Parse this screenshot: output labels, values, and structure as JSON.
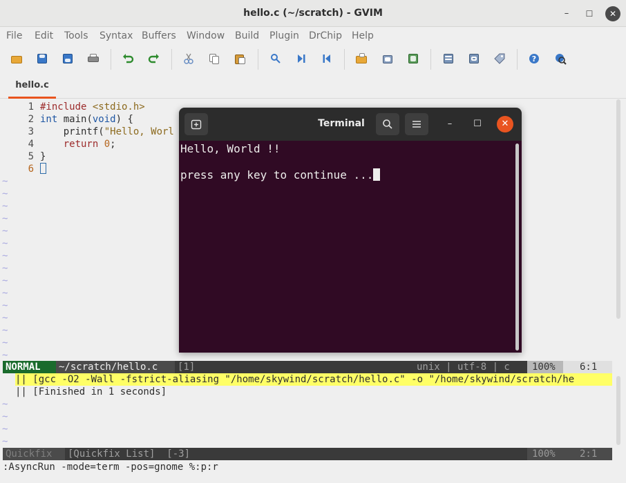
{
  "window": {
    "title": "hello.c (~/scratch) - GVIM"
  },
  "menu": [
    "File",
    "Edit",
    "Tools",
    "Syntax",
    "Buffers",
    "Window",
    "Build",
    "Plugin",
    "DrChip",
    "Help"
  ],
  "tab": {
    "label": "hello.c"
  },
  "editor": {
    "lines": [
      {
        "num": "1",
        "segments": [
          {
            "t": "#include ",
            "c": "kw"
          },
          {
            "t": "<stdio.h>",
            "c": "str"
          }
        ]
      },
      {
        "num": "2",
        "segments": [
          {
            "t": "int",
            "c": "ty"
          },
          {
            "t": " main(",
            "c": ""
          },
          {
            "t": "void",
            "c": "ty"
          },
          {
            "t": ") {",
            "c": ""
          }
        ]
      },
      {
        "num": "3",
        "segments": [
          {
            "t": "    printf(",
            "c": ""
          },
          {
            "t": "\"Hello, Worl",
            "c": "str"
          }
        ]
      },
      {
        "num": "4",
        "segments": [
          {
            "t": "    ",
            "c": ""
          },
          {
            "t": "return",
            "c": "kw"
          },
          {
            "t": " ",
            "c": ""
          },
          {
            "t": "0",
            "c": "num"
          },
          {
            "t": ";",
            "c": ""
          }
        ]
      },
      {
        "num": "5",
        "segments": [
          {
            "t": "}",
            "c": ""
          }
        ]
      },
      {
        "num": "6",
        "segments": []
      }
    ],
    "tilde": "~"
  },
  "status": {
    "mode": "NORMAL",
    "path": "~/scratch/hello.c",
    "buffer": "[1]",
    "fileinfo": "unix | utf-8 | c",
    "percent": "100%",
    "position": "6:1"
  },
  "quickfix": {
    "lines": [
      "|| [gcc -O2 -Wall -fstrict-aliasing \"/home/skywind/scratch/hello.c\" -o \"/home/skywind/scratch/he",
      "|| [Finished in 1 seconds]"
    ],
    "status_name": "Quickfix",
    "status_list": "[Quickfix List]  [-3]",
    "percent": "100%",
    "position": "2:1"
  },
  "cmdline": ":AsyncRun -mode=term -pos=gnome %:p:r",
  "terminal": {
    "title": "Terminal",
    "lines": [
      "Hello, World !!",
      "press any key to continue ..."
    ]
  }
}
